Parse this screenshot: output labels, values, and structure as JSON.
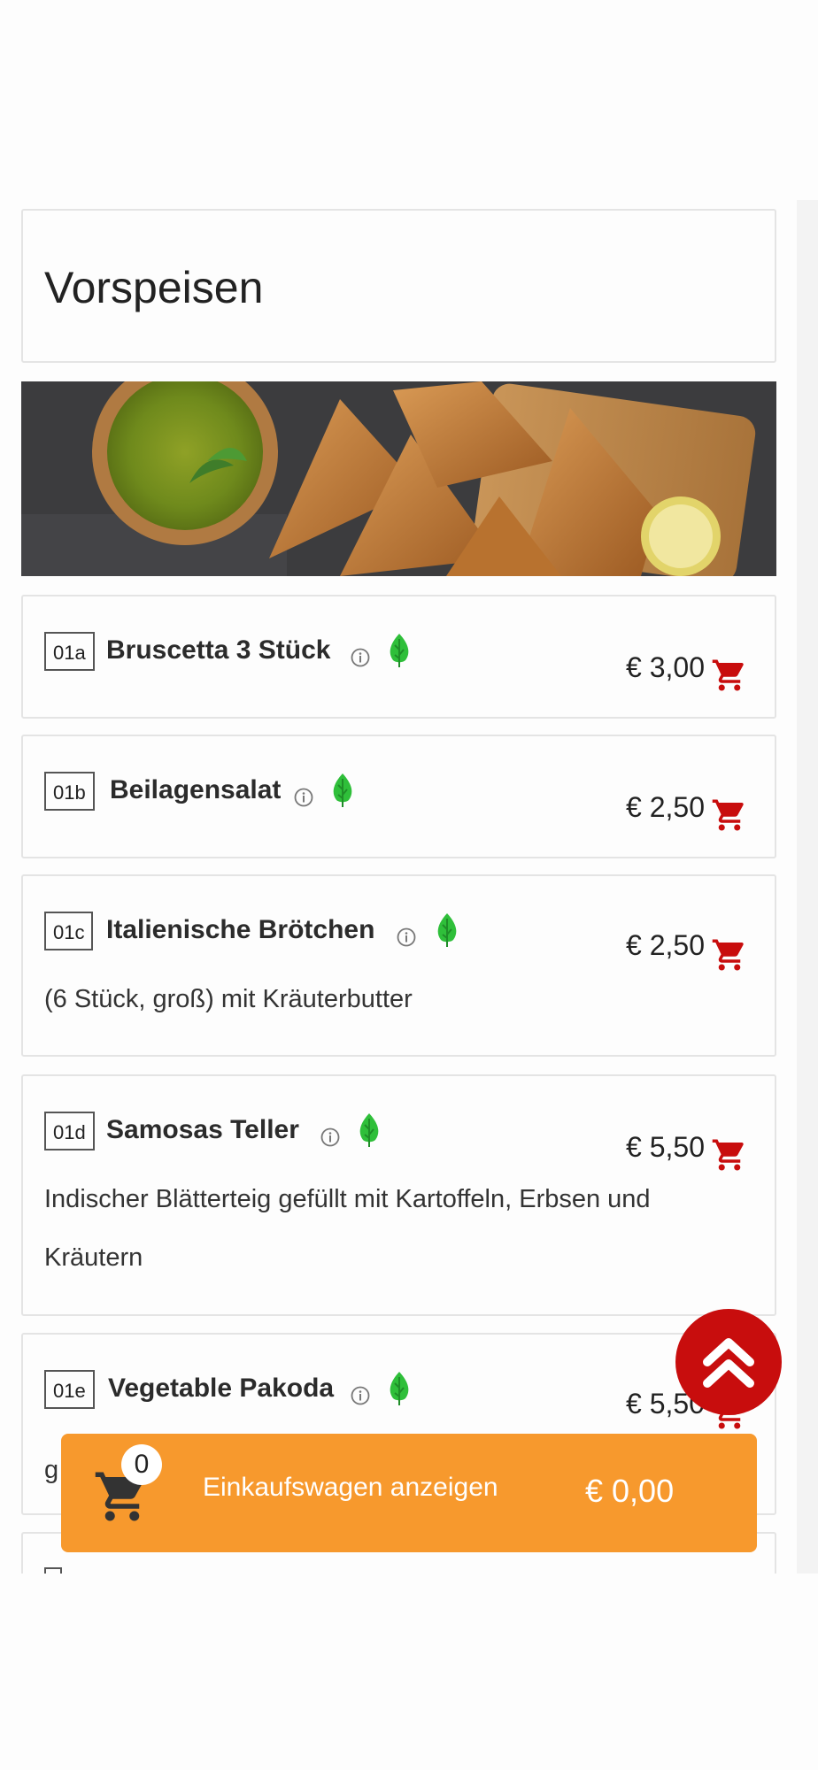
{
  "section": {
    "title": "Vorspeisen"
  },
  "banner": {
    "alt": "samosa-banner-image"
  },
  "items": [
    {
      "code": "01a",
      "name": "Bruscetta 3 Stück",
      "price": "€ 3,00",
      "description": ""
    },
    {
      "code": "01b",
      "name": "Beilagensalat",
      "price": "€ 2,50",
      "description": ""
    },
    {
      "code": "01c",
      "name": "Italienische Brötchen",
      "price": "€ 2,50",
      "description": "(6 Stück, groß) mit Kräuterbutter"
    },
    {
      "code": "01d",
      "name": "Samosas Teller",
      "price": "€ 5,50",
      "description": "Indischer Blätterteig gefüllt mit Kartoffeln, Erbsen und Kräutern"
    },
    {
      "code": "01e",
      "name": "Vegetable Pakoda",
      "price": "€ 5,50",
      "description": "g"
    }
  ],
  "cart_bar": {
    "count": "0",
    "label": "Einkaufswagen anzeigen",
    "total": "€ 0,00"
  },
  "icons": {
    "info": "info-circle-icon",
    "veg": "leaf-icon",
    "add_to_cart": "shopping-cart-icon",
    "scroll_top": "double-chevron-up-icon"
  },
  "colors": {
    "cart_icon": "#c80d0d",
    "leaf": "#2fbf3a",
    "cart_bar": "#f7992d",
    "scroll_top": "#c80d0d",
    "card_border": "#e4e4e4"
  }
}
